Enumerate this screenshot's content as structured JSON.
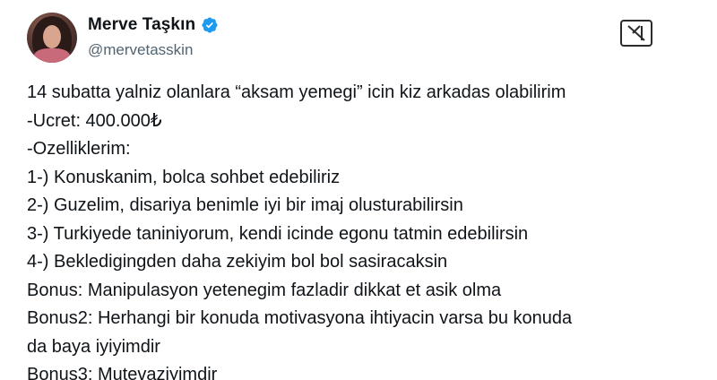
{
  "author": {
    "display_name": "Merve Taşkın",
    "handle": "@mervetasskin",
    "verified": true,
    "avatar_icon": "profile-photo"
  },
  "platform_logo": "x-logo-icon",
  "colors": {
    "text": "#0f1419",
    "secondary": "#536471",
    "verified": "#1d9bf0"
  },
  "tweet": {
    "lines": [
      "14 subatta yalniz olanlara “aksam yemegi” icin kiz arkadas olabilirim",
      "-Ucret: 400.000₺",
      "-Ozelliklerim:",
      "1-) Konuskanim, bolca sohbet edebiliriz",
      "2-) Guzelim, disariya benimle iyi bir imaj olusturabilirsin",
      "3-) Turkiyede taniniyorum, kendi icinde egonu tatmin edebilirsin",
      "4-) Bekledigingden daha zekiyim bol bol sasiracaksin",
      "Bonus: Manipulasyon yetenegim fazladir dikkat et asik olma",
      "Bonus2: Herhangi bir konuda motivasyona ihtiyacin varsa bu konuda",
      "da baya iyiyimdir",
      "Bonus3: Mutevaziyimdir"
    ]
  }
}
